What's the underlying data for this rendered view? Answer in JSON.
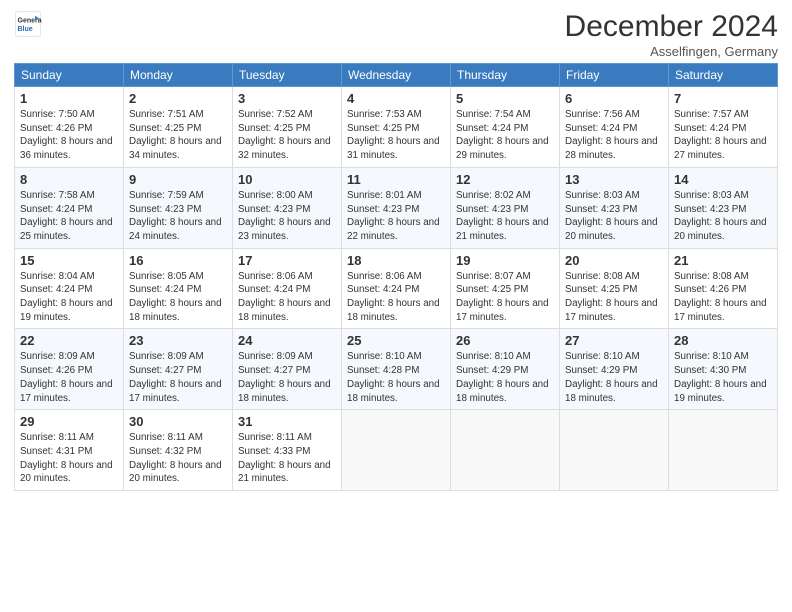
{
  "header": {
    "logo_general": "General",
    "logo_blue": "Blue",
    "month_title": "December 2024",
    "location": "Asselfingen, Germany"
  },
  "days_of_week": [
    "Sunday",
    "Monday",
    "Tuesday",
    "Wednesday",
    "Thursday",
    "Friday",
    "Saturday"
  ],
  "weeks": [
    [
      {
        "day": "1",
        "sunrise": "7:50 AM",
        "sunset": "4:26 PM",
        "daylight": "8 hours and 36 minutes."
      },
      {
        "day": "2",
        "sunrise": "7:51 AM",
        "sunset": "4:25 PM",
        "daylight": "8 hours and 34 minutes."
      },
      {
        "day": "3",
        "sunrise": "7:52 AM",
        "sunset": "4:25 PM",
        "daylight": "8 hours and 32 minutes."
      },
      {
        "day": "4",
        "sunrise": "7:53 AM",
        "sunset": "4:25 PM",
        "daylight": "8 hours and 31 minutes."
      },
      {
        "day": "5",
        "sunrise": "7:54 AM",
        "sunset": "4:24 PM",
        "daylight": "8 hours and 29 minutes."
      },
      {
        "day": "6",
        "sunrise": "7:56 AM",
        "sunset": "4:24 PM",
        "daylight": "8 hours and 28 minutes."
      },
      {
        "day": "7",
        "sunrise": "7:57 AM",
        "sunset": "4:24 PM",
        "daylight": "8 hours and 27 minutes."
      }
    ],
    [
      {
        "day": "8",
        "sunrise": "7:58 AM",
        "sunset": "4:24 PM",
        "daylight": "8 hours and 25 minutes."
      },
      {
        "day": "9",
        "sunrise": "7:59 AM",
        "sunset": "4:23 PM",
        "daylight": "8 hours and 24 minutes."
      },
      {
        "day": "10",
        "sunrise": "8:00 AM",
        "sunset": "4:23 PM",
        "daylight": "8 hours and 23 minutes."
      },
      {
        "day": "11",
        "sunrise": "8:01 AM",
        "sunset": "4:23 PM",
        "daylight": "8 hours and 22 minutes."
      },
      {
        "day": "12",
        "sunrise": "8:02 AM",
        "sunset": "4:23 PM",
        "daylight": "8 hours and 21 minutes."
      },
      {
        "day": "13",
        "sunrise": "8:03 AM",
        "sunset": "4:23 PM",
        "daylight": "8 hours and 20 minutes."
      },
      {
        "day": "14",
        "sunrise": "8:03 AM",
        "sunset": "4:23 PM",
        "daylight": "8 hours and 20 minutes."
      }
    ],
    [
      {
        "day": "15",
        "sunrise": "8:04 AM",
        "sunset": "4:24 PM",
        "daylight": "8 hours and 19 minutes."
      },
      {
        "day": "16",
        "sunrise": "8:05 AM",
        "sunset": "4:24 PM",
        "daylight": "8 hours and 18 minutes."
      },
      {
        "day": "17",
        "sunrise": "8:06 AM",
        "sunset": "4:24 PM",
        "daylight": "8 hours and 18 minutes."
      },
      {
        "day": "18",
        "sunrise": "8:06 AM",
        "sunset": "4:24 PM",
        "daylight": "8 hours and 18 minutes."
      },
      {
        "day": "19",
        "sunrise": "8:07 AM",
        "sunset": "4:25 PM",
        "daylight": "8 hours and 17 minutes."
      },
      {
        "day": "20",
        "sunrise": "8:08 AM",
        "sunset": "4:25 PM",
        "daylight": "8 hours and 17 minutes."
      },
      {
        "day": "21",
        "sunrise": "8:08 AM",
        "sunset": "4:26 PM",
        "daylight": "8 hours and 17 minutes."
      }
    ],
    [
      {
        "day": "22",
        "sunrise": "8:09 AM",
        "sunset": "4:26 PM",
        "daylight": "8 hours and 17 minutes."
      },
      {
        "day": "23",
        "sunrise": "8:09 AM",
        "sunset": "4:27 PM",
        "daylight": "8 hours and 17 minutes."
      },
      {
        "day": "24",
        "sunrise": "8:09 AM",
        "sunset": "4:27 PM",
        "daylight": "8 hours and 18 minutes."
      },
      {
        "day": "25",
        "sunrise": "8:10 AM",
        "sunset": "4:28 PM",
        "daylight": "8 hours and 18 minutes."
      },
      {
        "day": "26",
        "sunrise": "8:10 AM",
        "sunset": "4:29 PM",
        "daylight": "8 hours and 18 minutes."
      },
      {
        "day": "27",
        "sunrise": "8:10 AM",
        "sunset": "4:29 PM",
        "daylight": "8 hours and 18 minutes."
      },
      {
        "day": "28",
        "sunrise": "8:10 AM",
        "sunset": "4:30 PM",
        "daylight": "8 hours and 19 minutes."
      }
    ],
    [
      {
        "day": "29",
        "sunrise": "8:11 AM",
        "sunset": "4:31 PM",
        "daylight": "8 hours and 20 minutes."
      },
      {
        "day": "30",
        "sunrise": "8:11 AM",
        "sunset": "4:32 PM",
        "daylight": "8 hours and 20 minutes."
      },
      {
        "day": "31",
        "sunrise": "8:11 AM",
        "sunset": "4:33 PM",
        "daylight": "8 hours and 21 minutes."
      },
      null,
      null,
      null,
      null
    ]
  ],
  "labels": {
    "sunrise": "Sunrise:",
    "sunset": "Sunset:",
    "daylight": "Daylight:"
  }
}
